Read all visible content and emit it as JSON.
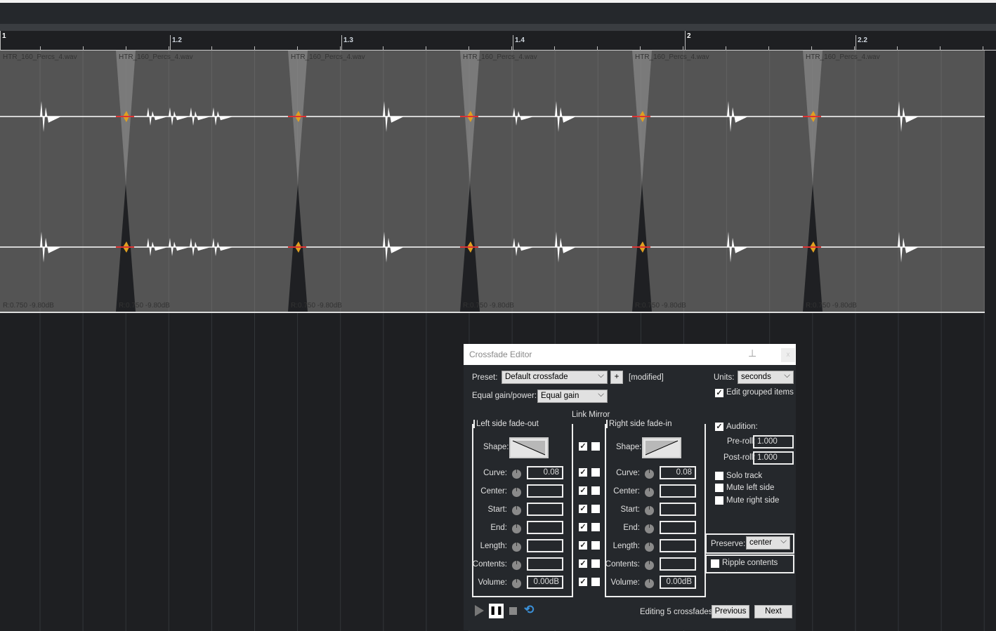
{
  "ruler": {
    "marks": [
      "1",
      "1.2",
      "1.3",
      "1.4",
      "2",
      "2.2"
    ]
  },
  "items": [
    {
      "name": "HTR_160_Percs_4.wav",
      "vol": "R:0.750 -9.80dB"
    },
    {
      "name": "HTR_160_Percs_4.wav",
      "vol": "R:0.750 -9.80dB"
    },
    {
      "name": "HTR_160_Percs_4.wav",
      "vol": "R:0.750 -9.80dB"
    },
    {
      "name": "HTR_160_Percs_4.wav",
      "vol": "R:0.750 -9.80dB"
    },
    {
      "name": "HTR_160_Percs_4.wav",
      "vol": "R:0.750 -9.80dB"
    },
    {
      "name": "HTR_160_Percs_4.wav",
      "vol": "R:0.750 -9.80dB"
    }
  ],
  "dialog": {
    "title": "Crossfade Editor",
    "close": "x",
    "preset_label": "Preset:",
    "preset_value": "Default crossfade",
    "plus": "+",
    "modified": "[modified]",
    "units_label": "Units:",
    "units_value": "seconds",
    "edit_grouped": "Edit grouped items",
    "eq_label": "Equal gain/power:",
    "eq_value": "Equal gain",
    "link_mirror": "Link Mirror",
    "left_title": "Left side fade-out",
    "right_title": "Right side fade-in",
    "shape_label": "Shape:",
    "rows": [
      {
        "label": "Curve:",
        "left": "0.08",
        "right": "0.08"
      },
      {
        "label": "Center:",
        "left": "",
        "right": ""
      },
      {
        "label": "Start:",
        "left": "",
        "right": ""
      },
      {
        "label": "End:",
        "left": "",
        "right": ""
      },
      {
        "label": "Length:",
        "left": "",
        "right": ""
      },
      {
        "label": "Contents:",
        "left": "",
        "right": ""
      },
      {
        "label": "Volume:",
        "left": "0.00dB",
        "right": "0.00dB"
      }
    ],
    "audition": "Audition:",
    "preroll_label": "Pre-roll:",
    "preroll": "1.000",
    "postroll_label": "Post-roll:",
    "postroll": "1.000",
    "solo": "Solo track",
    "mute_left": "Mute left side",
    "mute_right": "Mute right side",
    "preserve_label": "Preserve:",
    "preserve_value": "center",
    "ripple": "Ripple contents",
    "status": "Editing 5 crossfades",
    "previous": "Previous",
    "next": "Next"
  }
}
